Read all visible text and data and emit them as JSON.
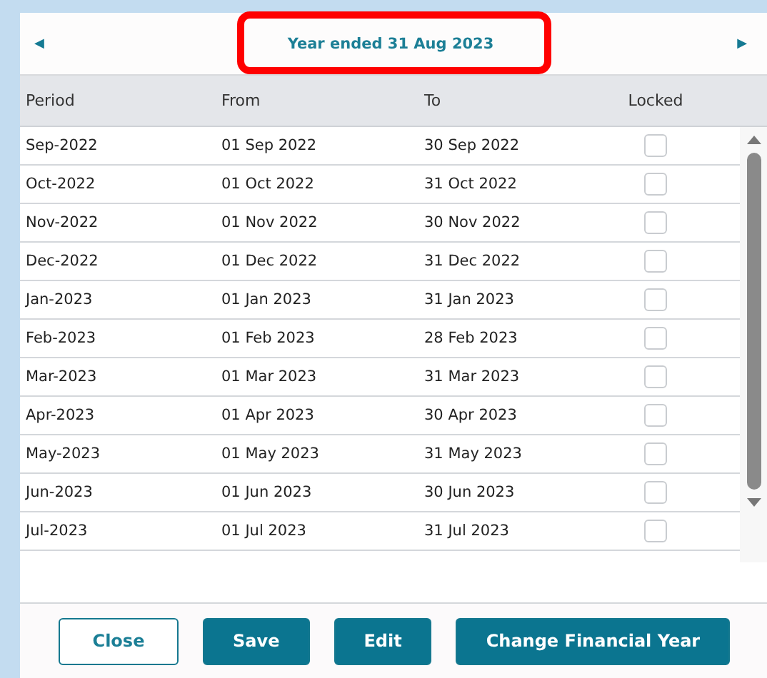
{
  "header": {
    "prev": "◀",
    "title": "Year ended 31 Aug 2023",
    "next": "▶",
    "highlighted": true
  },
  "table": {
    "columns": [
      "Period",
      "From",
      "To",
      "Locked"
    ],
    "rows": [
      {
        "period": "Sep-2022",
        "from": "01 Sep 2022",
        "to": "30 Sep 2022",
        "locked": false
      },
      {
        "period": "Oct-2022",
        "from": "01 Oct 2022",
        "to": "31 Oct 2022",
        "locked": false
      },
      {
        "period": "Nov-2022",
        "from": "01 Nov 2022",
        "to": "30 Nov 2022",
        "locked": false
      },
      {
        "period": "Dec-2022",
        "from": "01 Dec 2022",
        "to": "31 Dec 2022",
        "locked": false
      },
      {
        "period": "Jan-2023",
        "from": "01 Jan 2023",
        "to": "31 Jan 2023",
        "locked": false
      },
      {
        "period": "Feb-2023",
        "from": "01 Feb 2023",
        "to": "28 Feb 2023",
        "locked": false
      },
      {
        "period": "Mar-2023",
        "from": "01 Mar 2023",
        "to": "31 Mar 2023",
        "locked": false
      },
      {
        "period": "Apr-2023",
        "from": "01 Apr 2023",
        "to": "30 Apr 2023",
        "locked": false
      },
      {
        "period": "May-2023",
        "from": "01 May 2023",
        "to": "31 May 2023",
        "locked": false
      },
      {
        "period": "Jun-2023",
        "from": "01 Jun 2023",
        "to": "30 Jun 2023",
        "locked": false
      },
      {
        "period": "Jul-2023",
        "from": "01 Jul 2023",
        "to": "31 Jul 2023",
        "locked": false
      }
    ]
  },
  "buttons": [
    {
      "label": "Close",
      "kind": "outline"
    },
    {
      "label": "Save",
      "kind": "filled"
    },
    {
      "label": "Edit",
      "kind": "filled"
    },
    {
      "label": "Change Financial Year",
      "kind": "filled"
    }
  ]
}
